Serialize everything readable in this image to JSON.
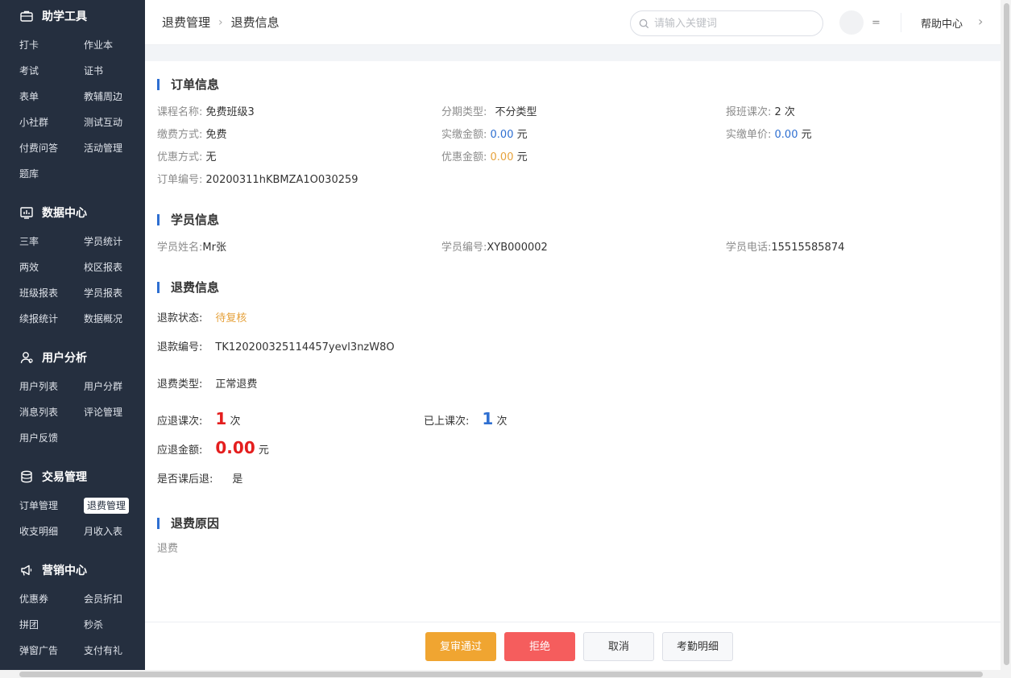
{
  "sidebar": {
    "sections": [
      {
        "title": "助学工具",
        "icon": "briefcase-icon",
        "items": [
          "打卡",
          "作业本",
          "考试",
          "证书",
          "表单",
          "教辅周边",
          "小社群",
          "测试互动",
          "付费问答",
          "活动管理",
          "题库"
        ]
      },
      {
        "title": "数据中心",
        "icon": "chart-icon",
        "items": [
          "三率",
          "学员统计",
          "两效",
          "校区报表",
          "班级报表",
          "学员报表",
          "续报统计",
          "数据概况"
        ]
      },
      {
        "title": "用户分析",
        "icon": "user-icon",
        "items": [
          "用户列表",
          "用户分群",
          "消息列表",
          "评论管理",
          "用户反馈"
        ]
      },
      {
        "title": "交易管理",
        "icon": "database-icon",
        "items": [
          "订单管理",
          "退费管理",
          "收支明细",
          "月收入表"
        ]
      },
      {
        "title": "营销中心",
        "icon": "megaphone-icon",
        "items": [
          "优惠券",
          "会员折扣",
          "拼团",
          "秒杀",
          "弹窗广告",
          "支付有礼"
        ]
      }
    ],
    "active_item": "退费管理"
  },
  "header": {
    "breadcrumb": [
      "退费管理",
      "退费信息"
    ],
    "search_placeholder": "请输入关键词",
    "menu_toggle": "=",
    "help": "帮助中心"
  },
  "order": {
    "title": "订单信息",
    "course_label": "课程名称:",
    "course": "免费班级3",
    "installment_label": "分期类型:",
    "installment": "不分类型",
    "enrolled_label": "报班课次:",
    "enrolled": "2 次",
    "pay_method_label": "缴费方式:",
    "pay_method": "免费",
    "paid_label": "实缴金额:",
    "paid": "0.00",
    "paid_unit": "元",
    "unit_price_label": "实缴单价:",
    "unit_price": "0.00",
    "unit_price_unit": "元",
    "discount_method_label": "优惠方式:",
    "discount_method": "无",
    "discount_amount_label": "优惠金额:",
    "discount_amount": "0.00",
    "discount_unit": "元",
    "order_no_label": "订单编号:",
    "order_no": "20200311hKBMZA1O030259"
  },
  "student": {
    "title": "学员信息",
    "name_label": "学员姓名:",
    "name": "Mr张",
    "no_label": "学员编号:",
    "no": "XYB000002",
    "phone_label": "学员电话:",
    "phone": "15515585874"
  },
  "refund": {
    "title": "退费信息",
    "status_label": "退款状态:",
    "status": "待复核",
    "no_label": "退款编号:",
    "no": "TK120200325114457yevl3nzW8O",
    "type_label": "退费类型:",
    "type": "正常退费",
    "refund_lessons_label": "应退课次:",
    "refund_lessons": "1",
    "refund_lessons_unit": "次",
    "attended_label": "已上课次:",
    "attended": "1",
    "attended_unit": "次",
    "amount_label": "应退金额:",
    "amount": "0.00",
    "amount_unit": "元",
    "after_class_label": "是否课后退:",
    "after_class": "是"
  },
  "reason": {
    "title": "退费原因",
    "text": "退费"
  },
  "footer": {
    "approve": "复审通过",
    "reject": "拒绝",
    "cancel": "取消",
    "attendance": "考勤明细"
  },
  "colors": {
    "sidebar_bg": "#252f3f",
    "accent_blue": "#2e6fd1",
    "orange": "#f0a531",
    "red": "#f55d5d",
    "highlight_red": "#e41e1e"
  }
}
